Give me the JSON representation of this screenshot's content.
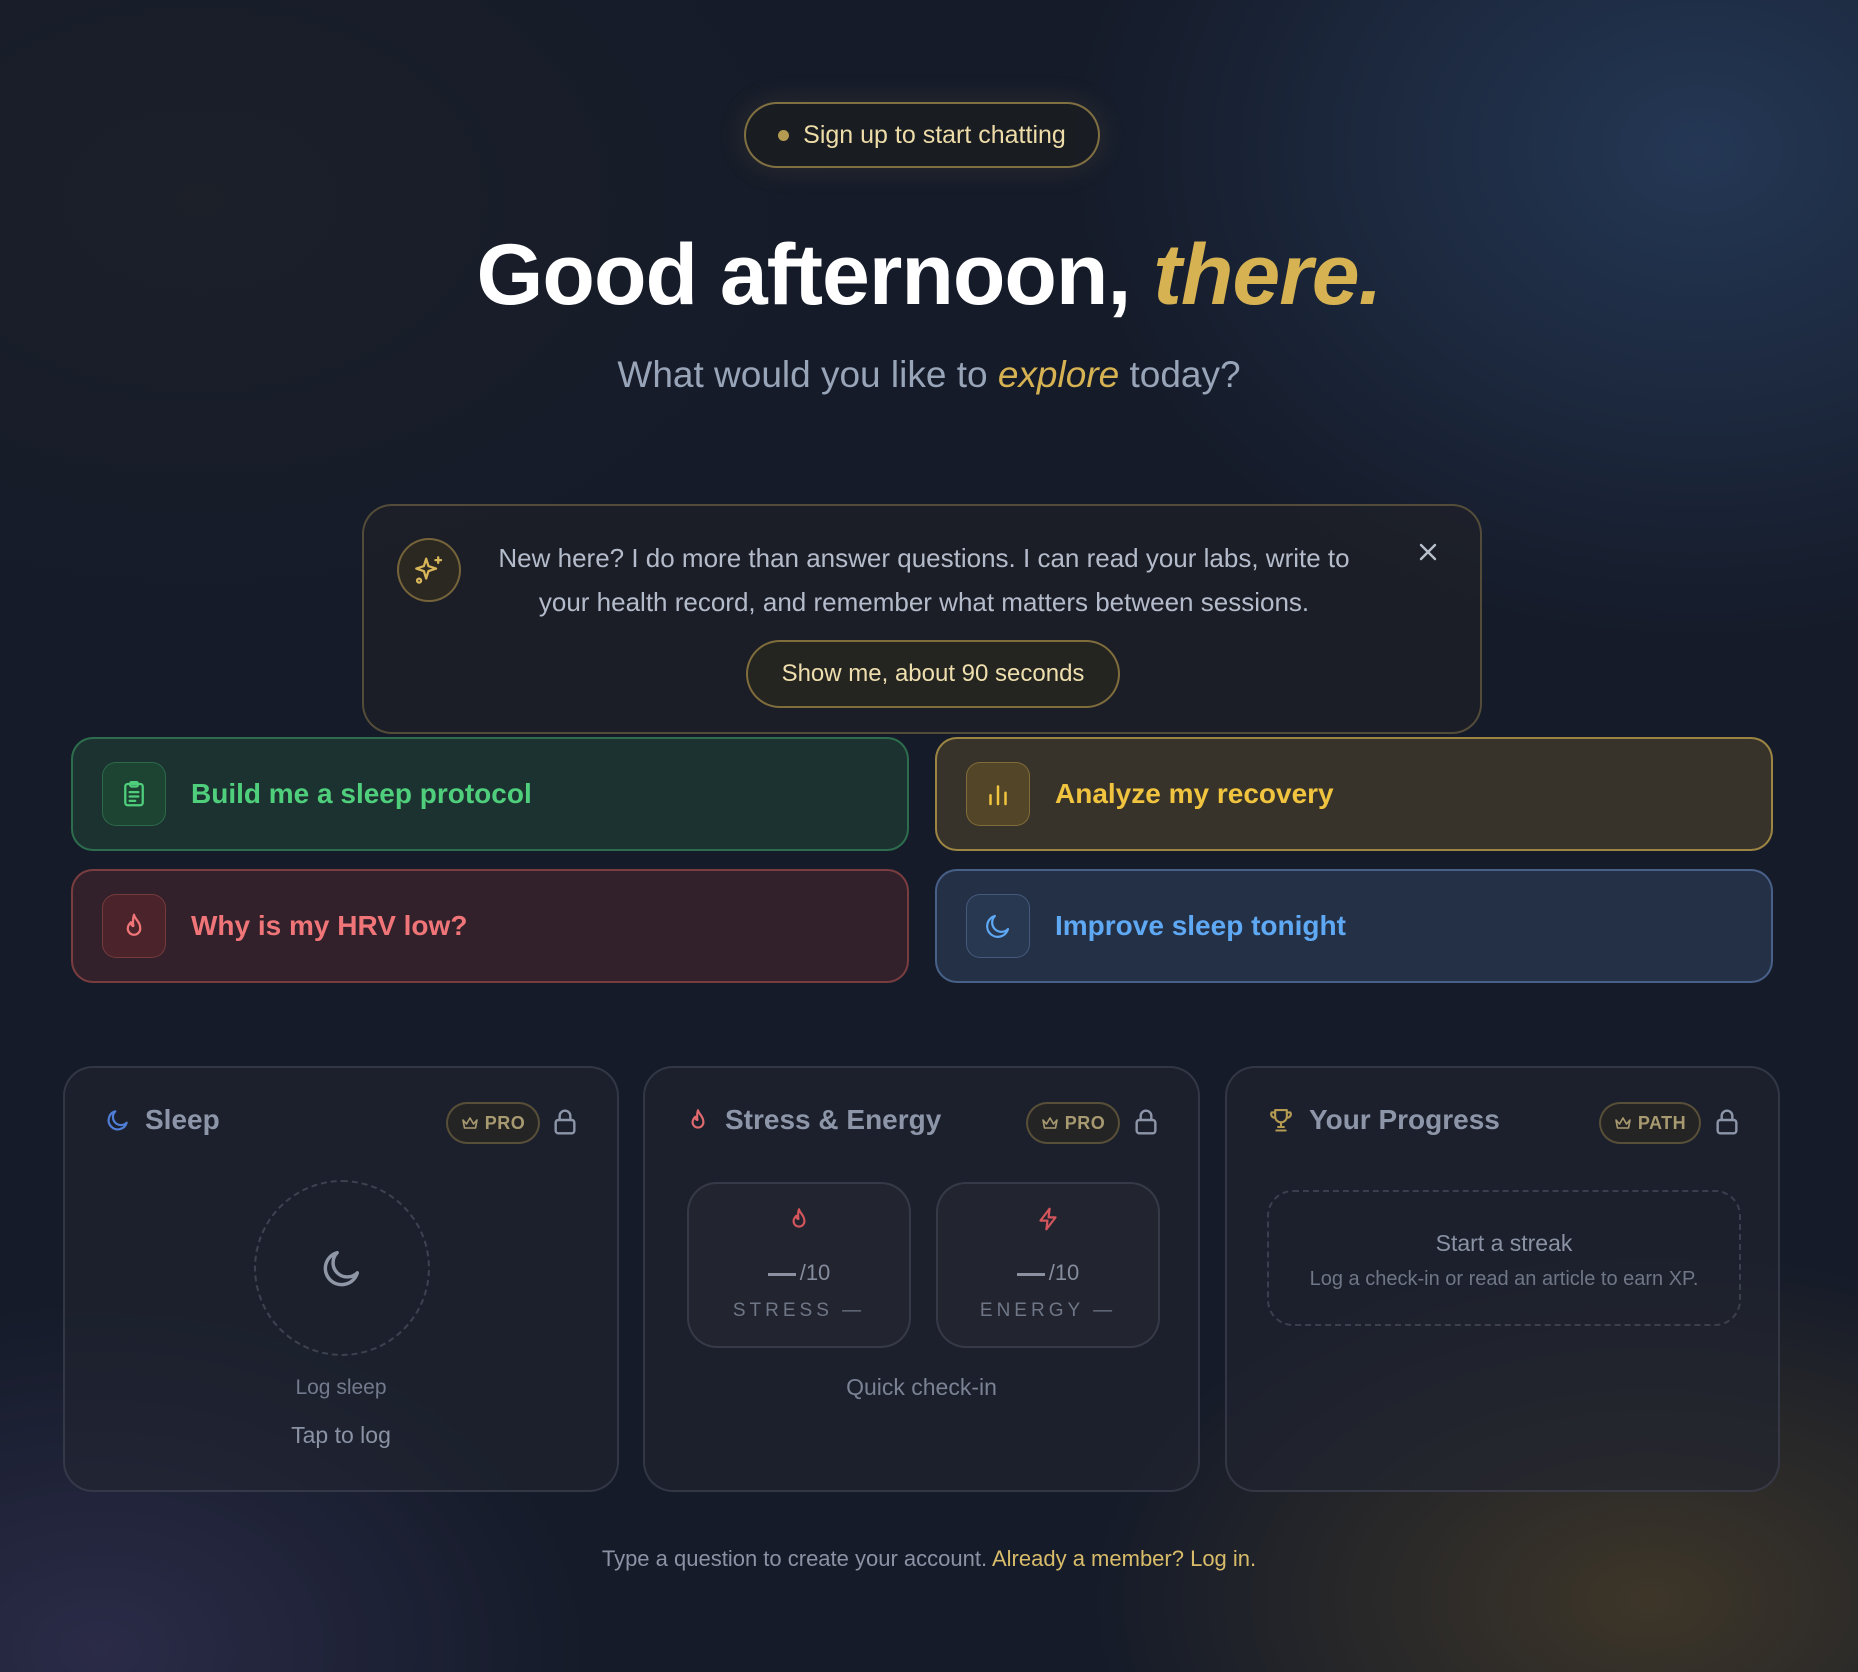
{
  "signup": {
    "label": "Sign up to start chatting"
  },
  "hero": {
    "greeting": "Good afternoon,",
    "name": "there.",
    "subtitle_before": "What would you like to",
    "subtitle_accent": "explore",
    "subtitle_after": "today?"
  },
  "intro": {
    "icon": "sparkle-icon",
    "text": "New here? I do more than answer questions. I can read your labs, write to your health record, and remember what matters between sessions.",
    "cta": "Show me, about 90 seconds",
    "close_icon": "close-icon"
  },
  "suggestions": [
    {
      "label": "Build me a sleep protocol",
      "icon": "clipboard-icon",
      "color": "#4fcf7c"
    },
    {
      "label": "Analyze my recovery",
      "icon": "bar-chart-icon",
      "color": "#f0c43e"
    },
    {
      "label": "Why is my HRV low?",
      "icon": "flame-icon",
      "color": "#f07578"
    },
    {
      "label": "Improve sleep tonight",
      "icon": "moon-icon",
      "color": "#5ea8f4"
    }
  ],
  "widgets": {
    "sleep": {
      "title": "Sleep",
      "badge": "PRO",
      "log_label": "Log sleep",
      "tap_label": "Tap to log"
    },
    "stress": {
      "title": "Stress & Energy",
      "badge": "PRO",
      "stress": {
        "value": "/10",
        "label": "STRESS —"
      },
      "energy": {
        "value": "/10",
        "label": "ENERGY —"
      },
      "quick_label": "Quick check-in"
    },
    "progress": {
      "title": "Your Progress",
      "badge": "PATH",
      "streak_title": "Start a streak",
      "streak_sub": "Log a check-in or read an article to earn XP."
    }
  },
  "footer": {
    "text": "Type a question to create your account.",
    "link": "Already a member? Log in."
  }
}
